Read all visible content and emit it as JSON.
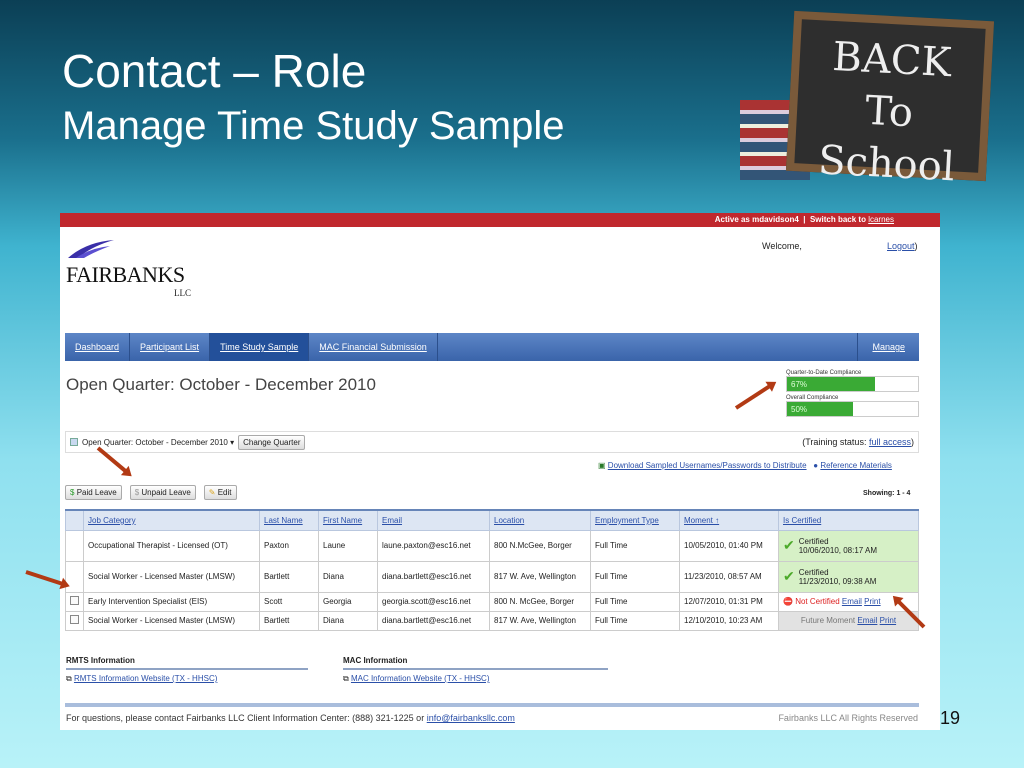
{
  "slide": {
    "title": "Contact – Role",
    "subtitle": "Manage Time Study Sample",
    "page_number": "19",
    "image_text": "BACK To School"
  },
  "topbar": {
    "active_as": "Active as mdavidson4",
    "separator": "|",
    "switch_back": "Switch back to",
    "switch_user": "lcarnes"
  },
  "header": {
    "logo_name": "FAIRBANKS",
    "logo_llc": "LLC",
    "welcome": "Welcome,",
    "logout": "Logout",
    ")": ")"
  },
  "nav": {
    "items": [
      "Dashboard",
      "Participant List",
      "Time Study Sample",
      "MAC Financial Submission"
    ],
    "manage": "Manage"
  },
  "main": {
    "heading": "Open Quarter: October - December 2010",
    "compliance": [
      {
        "label": "Quarter-to-Date Compliance",
        "value": 67,
        "text": "67%"
      },
      {
        "label": "Overall Compliance",
        "value": 50,
        "text": "50%"
      }
    ],
    "quarter_select": "Open Quarter: October - December 2010",
    "change_quarter": "Change Quarter",
    "training_prefix": "(Training status:",
    "training_link": "full access",
    "training_suffix": ")",
    "download_link": "Download Sampled Usernames/Passwords to Distribute",
    "reference_link": "Reference Materials",
    "buttons": {
      "paid": "Paid Leave",
      "unpaid": "Unpaid Leave",
      "edit": "Edit"
    },
    "showing": "Showing: 1 - 4",
    "columns": [
      "Job Category",
      "Last Name",
      "First Name",
      "Email",
      "Location",
      "Employment Type",
      "Moment ↑",
      "Is Certified"
    ],
    "rows": [
      {
        "job": "Occupational Therapist - Licensed (OT)",
        "last": "Paxton",
        "first": "Laune",
        "email": "laune.paxton@esc16.net",
        "location": "800 N.McGee, Borger",
        "type": "Full Time",
        "moment": "10/05/2010, 01:40 PM",
        "status": "Certified",
        "date": "10/06/2010, 08:17 AM"
      },
      {
        "job": "Social Worker - Licensed Master (LMSW)",
        "last": "Bartlett",
        "first": "Diana",
        "email": "diana.bartlett@esc16.net",
        "location": "817 W. Ave, Wellington",
        "type": "Full Time",
        "moment": "11/23/2010, 08:57 AM",
        "status": "Certified",
        "date": "11/23/2010, 09:38 AM"
      },
      {
        "job": "Early Intervention Specialist (EIS)",
        "last": "Scott",
        "first": "Georgia",
        "email": "georgia.scott@esc16.net",
        "location": "800 N. McGee, Borger",
        "type": "Full Time",
        "moment": "12/07/2010, 01:31 PM",
        "status": "Not Certified",
        "email_link": "Email",
        "print_link": "Print"
      },
      {
        "job": "Social Worker - Licensed Master (LMSW)",
        "last": "Bartlett",
        "first": "Diana",
        "email": "diana.bartlett@esc16.net",
        "location": "817 W. Ave, Wellington",
        "type": "Full Time",
        "moment": "12/10/2010, 10:23 AM",
        "status": "Future Moment",
        "email_link": "Email",
        "print_link": "Print"
      }
    ]
  },
  "footer": {
    "rmts_title": "RMTS Information",
    "rmts_link": "RMTS Information Website (TX - HHSC)",
    "mac_title": "MAC Information",
    "mac_link": "MAC Information Website (TX - HHSC)",
    "contact": "For questions, please contact Fairbanks LLC Client Information Center: (888) 321-1225 or",
    "contact_email": "info@fairbanksllc.com",
    "rights": "Fairbanks LLC All Rights Reserved"
  }
}
